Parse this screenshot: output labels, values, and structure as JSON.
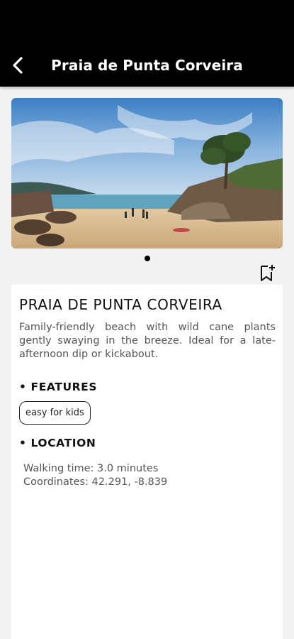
{
  "header": {
    "title": "Praia de Punta Corveira",
    "back_icon": "chevron-left-icon"
  },
  "gallery": {
    "image_description_name": "beach-photo",
    "pager_count": 1,
    "active_index": 0,
    "bookmark_icon": "bookmark-add-icon"
  },
  "details": {
    "name": "PRAIA DE PUNTA CORVEIRA",
    "description": "Family-friendly beach with wild cane plants gently swaying in the breeze. Ideal for a late-afternoon dip or kickabout.",
    "features_heading": "• FEATURES",
    "features": [
      "easy for kids"
    ],
    "location_heading": "• LOCATION",
    "walking_time": "Walking time: 3.0 minutes",
    "coordinates": "Coordinates: 42.291, -8.839"
  },
  "colors": {
    "header_bg": "#000000",
    "page_bg": "#f2f2f2",
    "card_bg": "#ffffff"
  }
}
